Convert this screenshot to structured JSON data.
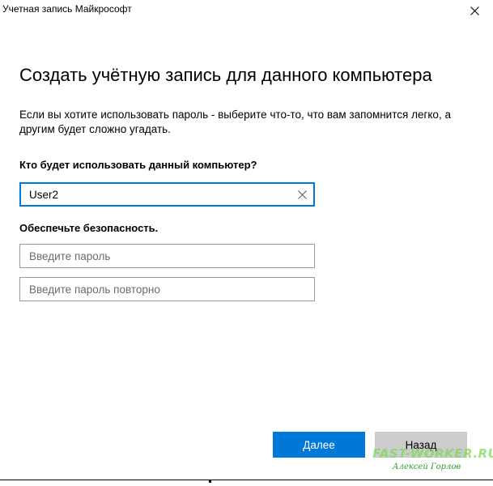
{
  "window": {
    "title": "Учетная запись Майкрософт",
    "close_icon": "close-icon"
  },
  "main": {
    "heading": "Создать учётную запись для данного компьютера",
    "description": "Если вы хотите использовать пароль - выберите что-то, что вам запомнится легко, а другим будет сложно угадать."
  },
  "user_section": {
    "label": "Кто будет использовать данный компьютер?",
    "username_value": "User2",
    "clear_icon": "clear-icon"
  },
  "security_section": {
    "label": "Обеспечьте безопасность.",
    "password_placeholder": "Введите пароль",
    "confirm_placeholder": "Введите пароль повторно"
  },
  "buttons": {
    "next_label": "Далее",
    "back_label": "Назад"
  },
  "watermark": {
    "site": "FAST-WORKER.RU",
    "author": "Алексей Горлов"
  },
  "colors": {
    "accent": "#0078d7",
    "button_secondary": "#cccccc",
    "watermark_green": "#7ed957"
  }
}
